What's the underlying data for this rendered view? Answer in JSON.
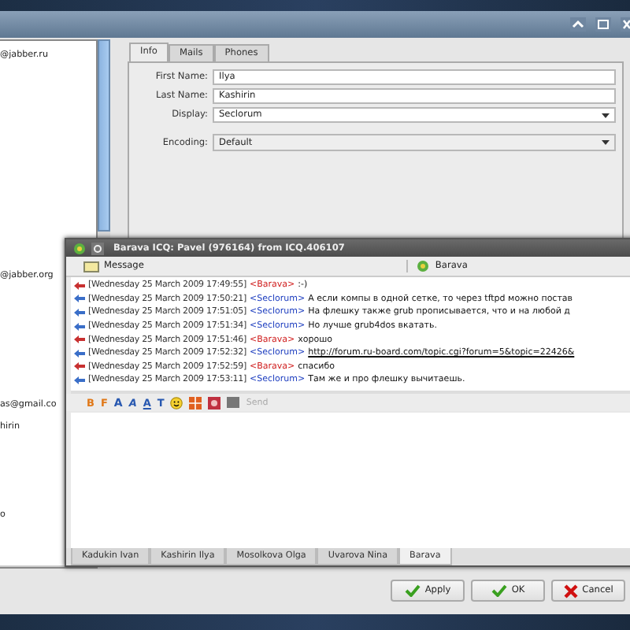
{
  "contact_list": {
    "items": [
      "@jabber.ru",
      "@jabber.org",
      "as@gmail.co",
      "hirin",
      "o"
    ]
  },
  "info_tabs": [
    {
      "label": "Info",
      "selected": true
    },
    {
      "label": "Mails",
      "selected": false
    },
    {
      "label": "Phones",
      "selected": false
    }
  ],
  "fields": [
    {
      "label": "First Name:",
      "value": "Ilya",
      "kind": "text"
    },
    {
      "label": "Last Name:",
      "value": "Kashirin",
      "kind": "text"
    },
    {
      "label": "Display:",
      "value": "Seclorum",
      "kind": "combo"
    },
    {
      "label": "Encoding:",
      "value": "Default",
      "kind": "dropdown"
    }
  ],
  "chat": {
    "title": "Barava ICQ: Pavel (976164) from ICQ.406107",
    "message_header": "Message",
    "contact_header": "Barava",
    "messages": [
      {
        "kind": "incoming",
        "time": "[Wednesday 25 March 2009 17:49:55]",
        "nick": "<Barava>",
        "text": ":-)",
        "link": false
      },
      {
        "kind": "outgoing",
        "time": "[Wednesday 25 March 2009 17:50:21]",
        "nick": "<Seclorum>",
        "text": "А если компы в одной сетке, то черeз tftpd можно постав",
        "link": false
      },
      {
        "kind": "outgoing",
        "time": "[Wednesday 25 March 2009 17:51:05]",
        "nick": "<Seclorum>",
        "text": "На флешку также grub прописывается, что и на любой д",
        "link": false
      },
      {
        "kind": "outgoing",
        "time": "[Wednesday 25 March 2009 17:51:34]",
        "nick": "<Seclorum>",
        "text": "Но лучше grub4dos вкатать.",
        "link": false
      },
      {
        "kind": "incoming",
        "time": "[Wednesday 25 March 2009 17:51:46]",
        "nick": "<Barava>",
        "text": "хорошо",
        "link": false
      },
      {
        "kind": "outgoing",
        "time": "[Wednesday 25 March 2009 17:52:32]",
        "nick": "<Seclorum>",
        "text": "http://forum.ru-board.com/topic.cgi?forum=5&topic=22426&",
        "link": true
      },
      {
        "kind": "incoming",
        "time": "[Wednesday 25 March 2009 17:52:59]",
        "nick": "<Barava>",
        "text": "спасибо",
        "link": false
      },
      {
        "kind": "outgoing",
        "time": "[Wednesday 25 March 2009 17:53:11]",
        "nick": "<Seclorum>",
        "text": "Там же и про флешку вычитаешь.",
        "link": false
      }
    ],
    "format_buttons": [
      {
        "glyph": "B",
        "kind": "bold"
      },
      {
        "glyph": "F",
        "kind": "font"
      },
      {
        "glyph": "A",
        "kind": "size"
      },
      {
        "glyph": "A",
        "kind": "italic"
      },
      {
        "glyph": "A",
        "kind": "underline"
      },
      {
        "glyph": "T",
        "kind": "text"
      }
    ],
    "send": {
      "label": "Send",
      "disabled": true
    },
    "tabs": [
      {
        "label": "Kadukin Ivan",
        "selected": false
      },
      {
        "label": "Kashirin Ilya",
        "selected": false
      },
      {
        "label": "Mosolkova Olga",
        "selected": false
      },
      {
        "label": "Uvarova Nina",
        "selected": false
      },
      {
        "label": "Barava",
        "selected": true
      }
    ]
  },
  "buttons": [
    {
      "label": "Apply",
      "kind": "apply"
    },
    {
      "label": "OK",
      "kind": "ok"
    },
    {
      "label": "Cancel",
      "kind": "cancel"
    }
  ]
}
